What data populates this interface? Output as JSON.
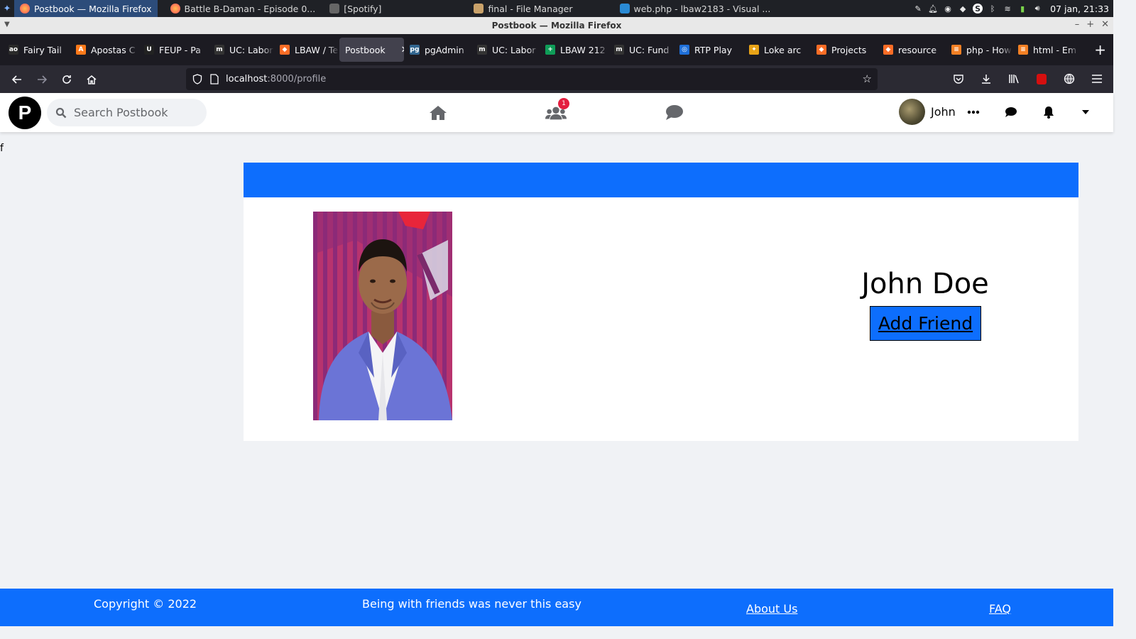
{
  "os_taskbar": {
    "tasks": [
      {
        "label": "Postbook — Mozilla Firefox",
        "active": true
      },
      {
        "label": "Battle B-Daman - Episode 0..."
      },
      {
        "label": "[Spotify]"
      },
      {
        "label": "final - File Manager"
      },
      {
        "label": "web.php - lbaw2183 - Visual ..."
      }
    ],
    "clock": "07 jan, 21:33"
  },
  "window": {
    "title": "Postbook — Mozilla Firefox"
  },
  "tabs": [
    {
      "label": "Fairy Tail",
      "icon": "ao-icon",
      "color": "#2a2a2a"
    },
    {
      "label": "Apostas C",
      "icon": "betting-icon",
      "color": "#ff7a1a"
    },
    {
      "label": "FEUP - Pa",
      "icon": "feup-icon",
      "color": "#222222"
    },
    {
      "label": "UC: Labor",
      "icon": "moodle-icon",
      "color": "#333333"
    },
    {
      "label": "LBAW / Te",
      "icon": "gitlab-icon",
      "color": "#fc6d26"
    },
    {
      "label": "Postbook",
      "active": true
    },
    {
      "label": "pgAdmin",
      "icon": "pgadmin-icon",
      "color": "#326690"
    },
    {
      "label": "UC: Labor",
      "icon": "moodle-icon",
      "color": "#333333"
    },
    {
      "label": "LBAW 212",
      "icon": "sheets-icon",
      "color": "#0f9d58"
    },
    {
      "label": "UC: Fund",
      "icon": "moodle-icon",
      "color": "#333333"
    },
    {
      "label": "RTP Play",
      "icon": "rtp-icon",
      "color": "#1e6fd9"
    },
    {
      "label": "Loke arc",
      "icon": "loke-icon",
      "color": "#e8a317"
    },
    {
      "label": "Projects",
      "icon": "gitlab-icon",
      "color": "#fc6d26"
    },
    {
      "label": "resource",
      "icon": "gitlab-icon",
      "color": "#fc6d26"
    },
    {
      "label": "php - How",
      "icon": "stackoverflow-icon",
      "color": "#f48024"
    },
    {
      "label": "html - Em",
      "icon": "stackoverflow-icon",
      "color": "#f48024"
    }
  ],
  "url": {
    "host": "localhost",
    "path": ":8000/profile"
  },
  "postbook": {
    "logo": "P",
    "search_placeholder": "Search Postbook",
    "friend_requests_count": "1",
    "user_name": "John"
  },
  "profile": {
    "stray_text": "f",
    "name": "John Doe",
    "add_friend_label": "Add Friend"
  },
  "footer": {
    "copyright": "Copyright © 2022",
    "tagline": "Being with friends was never this easy",
    "about_label": "About Us",
    "faq_label": "FAQ"
  },
  "colors": {
    "primary": "#0d6efd",
    "page_background": "#f0f2f5",
    "badge": "#e41e3f"
  }
}
